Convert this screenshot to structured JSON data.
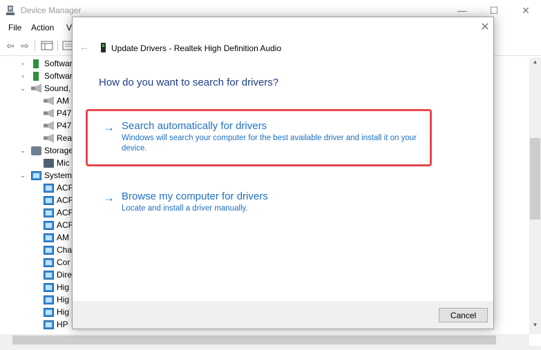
{
  "device_manager": {
    "title": "Device Manager",
    "window_controls": {
      "minimize": "—",
      "maximize": "☐",
      "close": "✕"
    },
    "menu": [
      "File",
      "Action",
      "V"
    ],
    "toolbar": {
      "back": "⇦",
      "forward": "⇨"
    },
    "tree": [
      {
        "label": "Softwar",
        "expander": "›",
        "icon": "software-component-icon"
      },
      {
        "label": "Softwar",
        "expander": "›",
        "icon": "software-device-icon"
      },
      {
        "label": "Sound, ",
        "expander": "⌄",
        "icon": "speaker-icon"
      },
      {
        "label": "AM",
        "expander": "",
        "icon": "speaker-icon"
      },
      {
        "label": "P47",
        "expander": "",
        "icon": "speaker-icon"
      },
      {
        "label": "P47",
        "expander": "",
        "icon": "speaker-icon"
      },
      {
        "label": "Rea",
        "expander": "",
        "icon": "speaker-icon"
      },
      {
        "label": "Storage",
        "expander": "⌄",
        "icon": "storage-icon"
      },
      {
        "label": "Mic",
        "expander": "",
        "icon": "storage-controller-icon"
      },
      {
        "label": "System",
        "expander": "⌄",
        "icon": "system-devices-icon"
      },
      {
        "label": "ACF",
        "expander": "",
        "icon": "system-device-icon"
      },
      {
        "label": "ACF",
        "expander": "",
        "icon": "system-device-icon"
      },
      {
        "label": "ACF",
        "expander": "",
        "icon": "system-device-icon"
      },
      {
        "label": "ACF",
        "expander": "",
        "icon": "system-device-icon"
      },
      {
        "label": "AM",
        "expander": "",
        "icon": "system-device-icon"
      },
      {
        "label": "Cha",
        "expander": "",
        "icon": "system-device-icon"
      },
      {
        "label": "Cor",
        "expander": "",
        "icon": "system-device-icon"
      },
      {
        "label": "Dire",
        "expander": "",
        "icon": "system-device-icon"
      },
      {
        "label": "Hig",
        "expander": "",
        "icon": "system-device-icon"
      },
      {
        "label": "Hig",
        "expander": "",
        "icon": "system-device-icon"
      },
      {
        "label": "Hig",
        "expander": "",
        "icon": "system-device-icon"
      },
      {
        "label": "HP",
        "expander": "",
        "icon": "system-device-icon"
      }
    ]
  },
  "dialog": {
    "title": "Update Drivers - Realtek High Definition Audio",
    "close_glyph": "✕",
    "back_glyph": "←",
    "heading": "How do you want to search for drivers?",
    "options": [
      {
        "arrow": "→",
        "title": "Search automatically for drivers",
        "description": "Windows will search your computer for the best available driver and install it on your device."
      },
      {
        "arrow": "→",
        "title": "Browse my computer for drivers",
        "description": "Locate and install a driver manually."
      }
    ],
    "cancel_label": "Cancel",
    "highlight_color": "#e8464d",
    "link_color": "#1f6fc3",
    "heading_color": "#1c3e87"
  }
}
